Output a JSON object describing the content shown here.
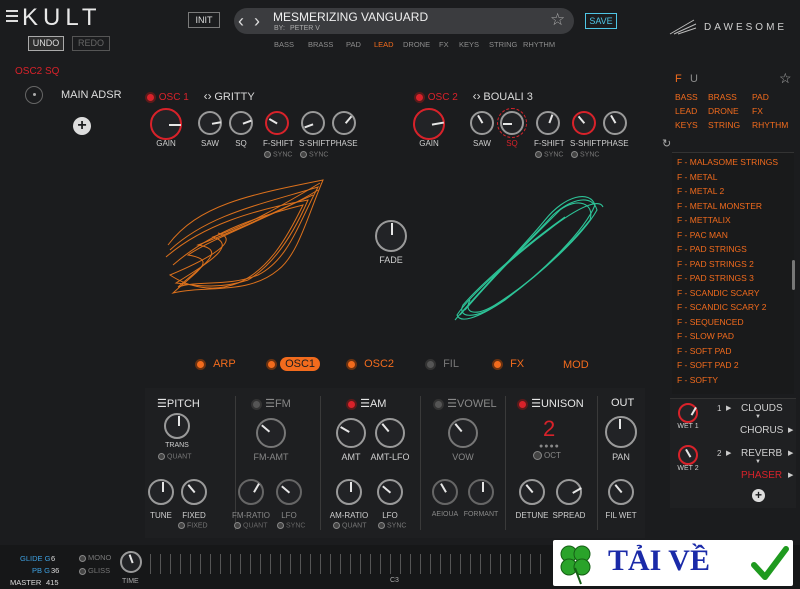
{
  "header": {
    "logo": "KULT",
    "undo": "UNDO",
    "redo": "REDO",
    "init": "INIT",
    "preset_name": "MESMERIZING VANGUARD",
    "author_prefix": "BY:",
    "author": "PETER V",
    "save": "SAVE",
    "brand": "DAWESOME",
    "categories": [
      "BASS",
      "BRASS",
      "PAD",
      "LEAD",
      "DRONE",
      "FX",
      "KEYS",
      "STRING",
      "RHYTHM"
    ],
    "selected_category": "LEAD"
  },
  "left": {
    "osc_label": "OSC2 SQ",
    "main_adsr": "MAIN ADSR"
  },
  "osc1": {
    "label": "OSC 1",
    "wave": "GRITTY",
    "knobs": [
      "GAIN",
      "SAW",
      "SQ",
      "F-SHIFT",
      "S-SHIFT",
      "PHASE"
    ],
    "sync": [
      "SYNC",
      "SYNC"
    ]
  },
  "osc2": {
    "label": "OSC 2",
    "wave": "BOUALI 3",
    "knobs": [
      "GAIN",
      "SAW",
      "SQ",
      "F-SHIFT",
      "S-SHIFT",
      "PHASE"
    ],
    "sync": [
      "SYNC",
      "SYNC"
    ]
  },
  "fade": "FADE",
  "tabs": [
    "ARP",
    "OSC1",
    "OSC2",
    "FIL",
    "FX",
    "MOD"
  ],
  "modules": {
    "pitch": {
      "title": "PITCH",
      "trans": "TRANS",
      "quant": "QUANT",
      "tune": "TUNE",
      "fixed": "FIXED",
      "fixed_opt": "FIXED"
    },
    "fm": {
      "title": "FM",
      "amt": "FM-AMT",
      "ratio": "FM-RATIO",
      "lfo": "LFO",
      "quant": "QUANT",
      "sync": "SYNC"
    },
    "am": {
      "title": "AM",
      "amt": "AMT",
      "amt_lfo": "AMT-LFO",
      "ratio": "AM-RATIO",
      "lfo": "LFO",
      "quant": "QUANT",
      "sync": "SYNC"
    },
    "vowel": {
      "title": "VOWEL",
      "vow": "VOW",
      "aeioua": "AEIOUA",
      "formant": "FORMANT"
    },
    "unison": {
      "title": "UNISON",
      "value": "2",
      "oct": "OCT",
      "detune": "DETUNE",
      "spread": "SPREAD"
    },
    "out": {
      "title": "OUT",
      "pan": "PAN",
      "fil_wet": "FIL WET"
    }
  },
  "browser": {
    "filters": [
      "F",
      "U"
    ],
    "cats": [
      [
        "BASS",
        "BRASS",
        "PAD"
      ],
      [
        "LEAD",
        "DRONE",
        "FX"
      ],
      [
        "KEYS",
        "STRING",
        "RHYTHM"
      ]
    ],
    "presets": [
      "F - MALASOME STRINGS",
      "F - METAL",
      "F - METAL 2",
      "F - METAL MONSTER",
      "F - METTALIX",
      "F - PAC MAN",
      "F - PAD STRINGS",
      "F - PAD STRINGS 2",
      "F - PAD STRINGS 3",
      "F - SCANDIC SCARY",
      "F - SCANDIC SCARY 2",
      "F - SEQUENCED",
      "F - SLOW PAD",
      "F - SOFT PAD",
      "F - SOFT PAD 2",
      "F - SOFTY"
    ]
  },
  "fx": {
    "wet1": "WET 1",
    "wet2": "WET 2",
    "slot1_num": "1",
    "slot2_num": "2",
    "slot1": [
      "CLOUDS",
      "CHORUS"
    ],
    "slot2": [
      "REVERB",
      "PHASER"
    ]
  },
  "bottom": {
    "glide_label": "GLIDE G",
    "glide_val": "6",
    "pb_label": "PB G",
    "pb_val": "36",
    "master_label": "MASTER",
    "master_val": "415",
    "mono": "MONO",
    "gliss": "GLISS",
    "time": "TIME",
    "key": "C3"
  },
  "watermark": "TẢI VỀ",
  "colors": {
    "accent": "#f26b1d",
    "red": "#d8222a",
    "teal": "#2fd6a5",
    "blue_label": "#3ea0e0"
  }
}
